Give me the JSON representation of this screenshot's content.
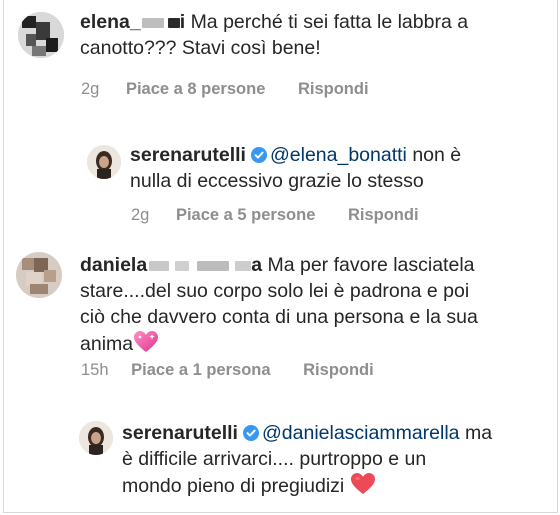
{
  "comments": [
    {
      "username": "elena_",
      "username_tail": "i",
      "text_line1": "Ma perché ti sei fatta le labbra a",
      "text_line2": "canotto??? Stavi così bene!",
      "time": "2g",
      "likes": "Piace a 8 persone",
      "reply": "Rispondi"
    },
    {
      "username": "serenarutelli",
      "mention": "@elena_bonatti",
      "text_line1": "non è",
      "text_line2": "nulla di eccessivo grazie lo stesso",
      "time": "2g",
      "likes": "Piace a 5 persone",
      "reply": "Rispondi"
    },
    {
      "username": "daniela",
      "username_tail": "a",
      "text_line1": "Ma per favore lasciatela",
      "text_line2": "stare....del suo corpo solo lei è padrona e poi",
      "text_line3": "ciò che davvero conta di una persona e la sua",
      "text_line4": "anima",
      "emoji": "sparkling-heart",
      "time": "15h",
      "likes": "Piace a 1 persona",
      "reply": "Rispondi"
    },
    {
      "username": "serenarutelli",
      "mention": "@danielasciammarella",
      "text_line1": "ma",
      "text_line2": "è difficile arrivarci.... purtroppo e un",
      "text_line3": "mondo pieno di pregiudizi",
      "emoji": "red-heart"
    }
  ],
  "colors": {
    "text": "#262626",
    "secondary": "#8e8e8e",
    "mention": "#00376b",
    "verified": "#3897f0",
    "heart_red": "#ed4956"
  }
}
